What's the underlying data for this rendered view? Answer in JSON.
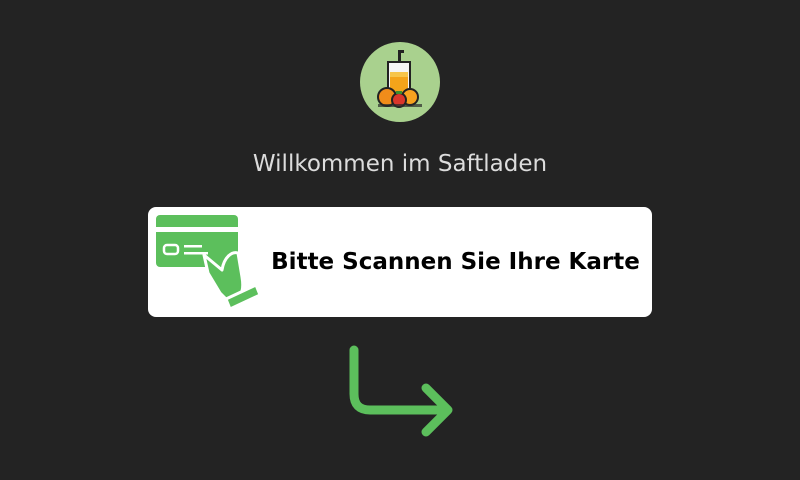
{
  "logo": {
    "icon": "juice-glass-fruit-icon",
    "background": "#a9d18e"
  },
  "welcome_text": "Willkommen im Saftladen",
  "scan_prompt": {
    "label": "Bitte Scannen Sie Ihre Karte",
    "icon": "card-in-hand-icon",
    "accent": "#5cbf5c"
  },
  "arrow": {
    "icon": "arrow-down-right-icon",
    "color": "#5cbf5c"
  }
}
